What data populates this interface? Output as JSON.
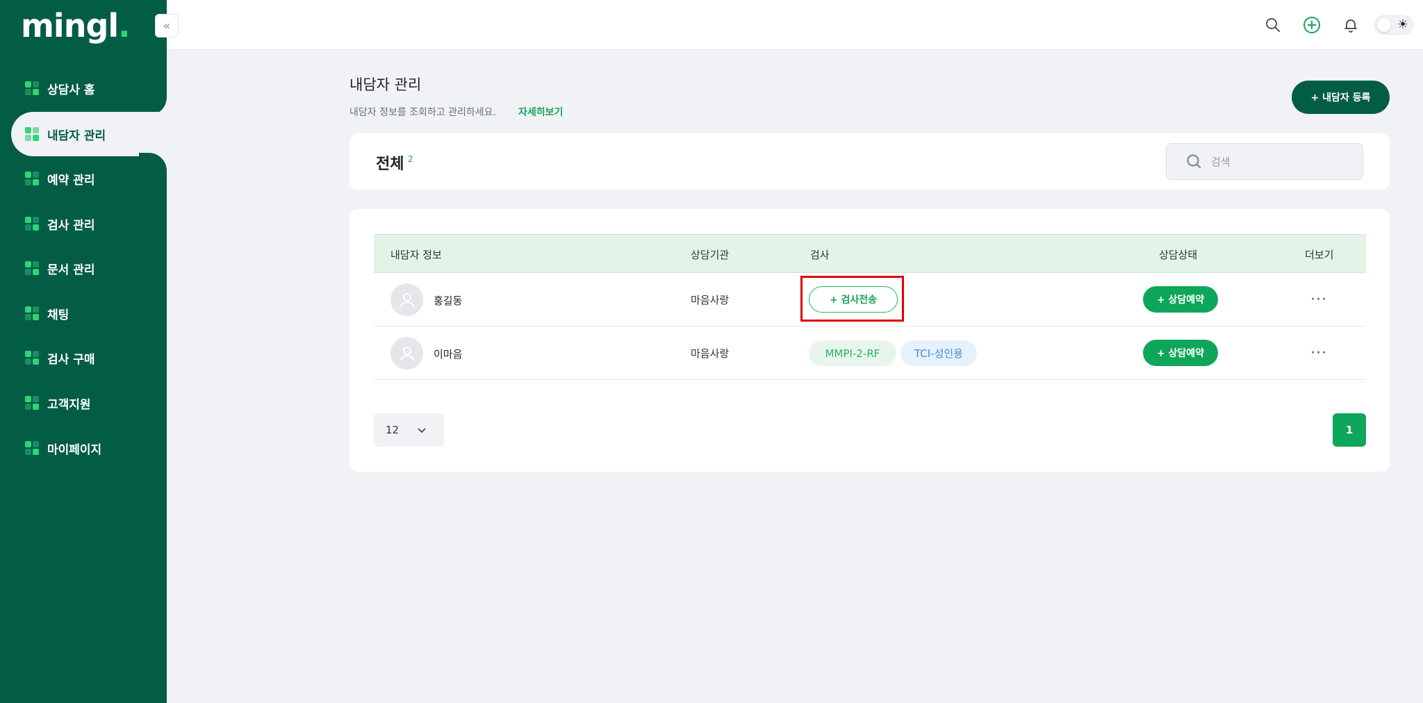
{
  "brand": {
    "logo": "mingl",
    "logo_dot": ".",
    "accent": "#035c44",
    "green": "#0da65a"
  },
  "sidebar": {
    "collapse_icon": "double-chevron-left-icon",
    "items": [
      {
        "label": "상담사 홈",
        "icon": "dashboard-icon"
      },
      {
        "label": "내담자 관리",
        "icon": "client-card-icon",
        "active": true
      },
      {
        "label": "예약 관리",
        "icon": "reservation-icon"
      },
      {
        "label": "검사 관리",
        "icon": "test-icon"
      },
      {
        "label": "문서 관리",
        "icon": "document-icon"
      },
      {
        "label": "채팅",
        "icon": "chat-icon"
      },
      {
        "label": "검사 구매",
        "icon": "purchase-icon"
      },
      {
        "label": "고객지원",
        "icon": "support-icon"
      },
      {
        "label": "마이페이지",
        "icon": "user-icon"
      }
    ]
  },
  "topbar": {
    "icons": [
      "search-icon",
      "plus-circle-icon",
      "bell-icon",
      "theme-toggle"
    ],
    "theme_icon": "☀"
  },
  "page": {
    "title": "내담자 관리",
    "subtitle": "내담자 정보를 조회하고 관리하세요.",
    "subtitle_link": "자세히보기",
    "add_button": "+  내담자 등록"
  },
  "filter": {
    "total_label": "전체",
    "total_count": "2",
    "search_placeholder": "검색"
  },
  "table": {
    "columns": [
      "내담자 정보",
      "상담기관",
      "검사",
      "상담상태",
      "더보기"
    ],
    "rows": [
      {
        "name": "홍길동",
        "org": "마음사랑",
        "test_action": "+ 검사전송",
        "status_action": "+ 상담예약",
        "more": "···"
      },
      {
        "name": "이마음",
        "org": "마음사랑",
        "tags": [
          "MMPI-2-RF",
          "TCI-성인용"
        ],
        "status_action": "+ 상담예약",
        "more": "···"
      }
    ]
  },
  "pagination": {
    "page_size": "12",
    "current_page": "1"
  }
}
